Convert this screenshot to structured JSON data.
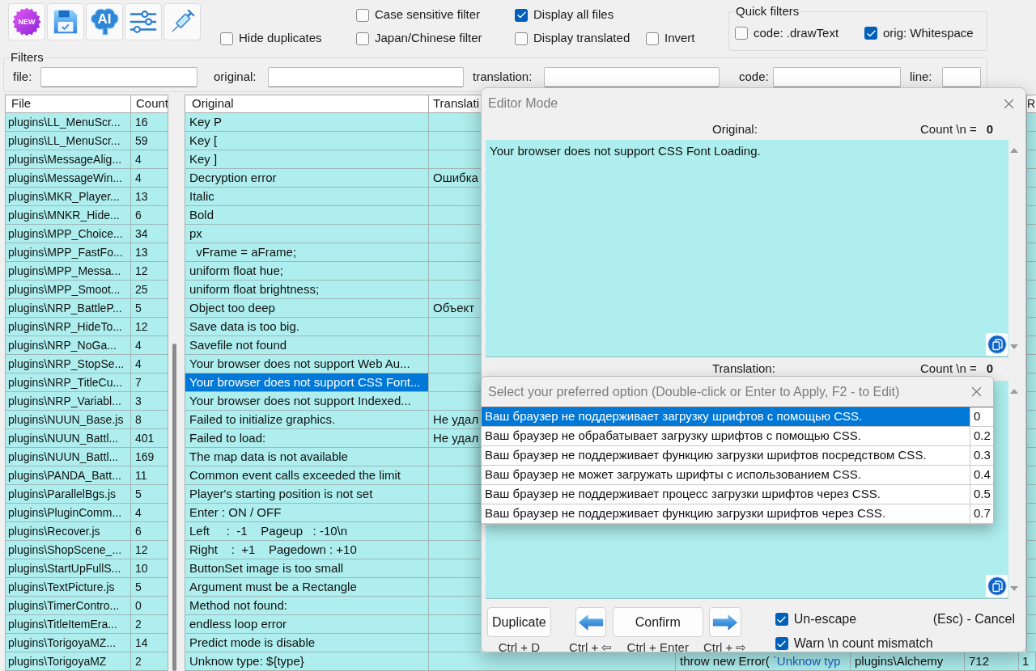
{
  "toolbar": [
    {
      "kind": "new",
      "label": "NEW"
    },
    {
      "kind": "save"
    },
    {
      "kind": "ai",
      "label": "AI"
    },
    {
      "kind": "sliders"
    },
    {
      "kind": "syringe"
    }
  ],
  "option_columns": [
    {
      "bottom": {
        "label": "Hide duplicates",
        "checked": false
      }
    },
    {
      "top": {
        "label": "Case sensitive filter",
        "checked": false
      },
      "bottom": {
        "label": "Japan/Chinese filter",
        "checked": false
      }
    },
    {
      "top": {
        "label": "Display all files",
        "checked": true
      },
      "bottom": {
        "label": "Display translated",
        "checked": false
      }
    },
    {
      "bottom": {
        "label": "Invert",
        "checked": false
      }
    }
  ],
  "quick_filters": {
    "title": "Quick filters",
    "items": [
      {
        "label": "code: .drawText",
        "checked": false
      },
      {
        "label": "orig: Whitespace",
        "checked": true
      }
    ]
  },
  "filters": {
    "title": "Filters",
    "fields": [
      {
        "label": "file:"
      },
      {
        "label": "original:"
      },
      {
        "label": "translation:"
      },
      {
        "label": "code:"
      },
      {
        "label": "line:"
      }
    ]
  },
  "file_table": {
    "columns": [
      "File",
      "Count"
    ],
    "rows": [
      {
        "file": "plugins\\LL_MenuScr...",
        "count": "16"
      },
      {
        "file": "plugins\\LL_MenuScr...",
        "count": "59"
      },
      {
        "file": "plugins\\MessageAlig...",
        "count": "4"
      },
      {
        "file": "plugins\\MessageWin...",
        "count": "4"
      },
      {
        "file": "plugins\\MKR_Player...",
        "count": "13"
      },
      {
        "file": "plugins\\MNKR_Hide...",
        "count": "6"
      },
      {
        "file": "plugins\\MPP_Choice...",
        "count": "34"
      },
      {
        "file": "plugins\\MPP_FastFo...",
        "count": "13"
      },
      {
        "file": "plugins\\MPP_Messa...",
        "count": "12"
      },
      {
        "file": "plugins\\MPP_Smoot...",
        "count": "25"
      },
      {
        "file": "plugins\\NRP_BattleP...",
        "count": "5"
      },
      {
        "file": "plugins\\NRP_HideTo...",
        "count": "12"
      },
      {
        "file": "plugins\\NRP_NoGa...",
        "count": "4"
      },
      {
        "file": "plugins\\NRP_StopSe...",
        "count": "4"
      },
      {
        "file": "plugins\\NRP_TitleCu...",
        "count": "7"
      },
      {
        "file": "plugins\\NRP_Variabl...",
        "count": "3"
      },
      {
        "file": "plugins\\NUUN_Base.js",
        "count": "8"
      },
      {
        "file": "plugins\\NUUN_Battl...",
        "count": "401"
      },
      {
        "file": "plugins\\NUUN_Battl...",
        "count": "169"
      },
      {
        "file": "plugins\\PANDA_Batt...",
        "count": "11"
      },
      {
        "file": "plugins\\ParallelBgs.js",
        "count": "5"
      },
      {
        "file": "plugins\\PluginComm...",
        "count": "4"
      },
      {
        "file": "plugins\\Recover.js",
        "count": "6"
      },
      {
        "file": "plugins\\ShopScene_...",
        "count": "12"
      },
      {
        "file": "plugins\\StartUpFullS...",
        "count": "10"
      },
      {
        "file": "plugins\\TextPicture.js",
        "count": "5"
      },
      {
        "file": "plugins\\TimerContro...",
        "count": "0"
      },
      {
        "file": "plugins\\TitleItemEra...",
        "count": "2"
      },
      {
        "file": "plugins\\TorigoyaMZ...",
        "count": "14"
      },
      {
        "file": "plugins\\TorigoyaMZ",
        "count": "2"
      }
    ]
  },
  "string_table": {
    "columns": {
      "original": "Original",
      "translation": "Translati",
      "column_6": "R"
    },
    "rows": [
      {
        "original": "Key P",
        "selected": false
      },
      {
        "original": "Key [",
        "selected": false
      },
      {
        "original": "Key ]",
        "selected": false
      },
      {
        "original": "Decryption error",
        "translation": "Ошибка",
        "selected": false
      },
      {
        "original": "Italic",
        "selected": false
      },
      {
        "original": "Bold",
        "selected": false
      },
      {
        "original": "px",
        "selected": false
      },
      {
        "original": "  vFrame = aFrame;",
        "selected": false
      },
      {
        "original": "uniform float hue;",
        "selected": false
      },
      {
        "original": "uniform float brightness;",
        "selected": false
      },
      {
        "original": "Object too deep",
        "translation": "Объект",
        "selected": false
      },
      {
        "original": "Save data is too big.",
        "selected": false
      },
      {
        "original": "Savefile not found",
        "selected": false
      },
      {
        "original": "Your browser does not support Web Au...",
        "selected": false
      },
      {
        "original": "Your browser does not support CSS Font...",
        "selected": true
      },
      {
        "original": "Your browser does not support Indexed...",
        "selected": false
      },
      {
        "original": "Failed to initialize graphics.",
        "translation": "Не удал",
        "selected": false
      },
      {
        "original": "Failed to load:",
        "translation": "Не удал",
        "selected": false
      },
      {
        "original": "The map data is not available",
        "selected": false
      },
      {
        "original": "Common event calls exceeded the limit",
        "selected": false
      },
      {
        "original": "Player's starting position is not set",
        "selected": false
      },
      {
        "original": "Enter : ON / OFF",
        "selected": false
      },
      {
        "original": "Left     :  -1    Pageup   : -10\\n",
        "selected": false
      },
      {
        "original": "Right    :  +1    Pagedown : +10",
        "selected": false
      },
      {
        "original": "ButtonSet image is too small",
        "selected": false
      },
      {
        "original": "Argument must be a Rectangle",
        "selected": false
      },
      {
        "original": "Method not found:",
        "selected": false
      },
      {
        "original": "endless loop error",
        "selected": false
      },
      {
        "original": "Predict mode is disable",
        "selected": false
      },
      {
        "original": "Unknow type: ${type}",
        "selected": false,
        "column_3": [
          {
            "text": "throw new Error(",
            "kind": "plain"
          },
          {
            "text": "`Unknow typ",
            "kind": "string"
          }
        ],
        "column_4": "plugins\\Alchemy",
        "column_5": "712",
        "column_6": "1"
      }
    ]
  },
  "editor": {
    "title": "Editor Mode",
    "original": {
      "label": "Original:",
      "count_label": "Count \\n =",
      "count": "0",
      "text": "Your browser does not support CSS Font Loading."
    },
    "translation": {
      "label": "Translation:",
      "count_label": "Count \\n =",
      "count": "0"
    },
    "buttons": [
      {
        "kind": "text",
        "label": "Duplicate",
        "shortcut": "Ctrl + D"
      },
      {
        "kind": "prev",
        "shortcut": "Ctrl + ⇦"
      },
      {
        "kind": "text",
        "label": "Confirm",
        "shortcut": "Ctrl + Enter"
      },
      {
        "kind": "next",
        "shortcut": "Ctrl + ⇨"
      }
    ],
    "options": [
      {
        "label": "Un-escape",
        "checked": true
      },
      {
        "label": "Warn \\n count mismatch",
        "checked": true
      }
    ],
    "cancel_hint": "(Esc) - Cancel"
  },
  "suggestions": {
    "title": "Select your preferred option (Double-click or Enter to Apply, F2 - to Edit)",
    "options": [
      {
        "text": "Ваш браузер не поддерживает загрузку шрифтов с помощью CSS.",
        "score": "0",
        "selected": true
      },
      {
        "text": "Ваш браузер не обрабатывает загрузку шрифтов с помощью CSS.",
        "score": "0.2",
        "selected": false
      },
      {
        "text": "Ваш браузер не поддерживает функцию загрузки шрифтов посредством CSS.",
        "score": "0.3",
        "selected": false
      },
      {
        "text": "Ваш браузер не может загружать шрифты с использованием CSS.",
        "score": "0.4",
        "selected": false
      },
      {
        "text": "Ваш браузер не поддерживает процесс загрузки шрифтов через CSS.",
        "score": "0.5",
        "selected": false
      },
      {
        "text": "Ваш браузер не поддерживает функцию загрузки шрифтов через CSS.",
        "score": "0.7",
        "selected": false
      }
    ]
  }
}
